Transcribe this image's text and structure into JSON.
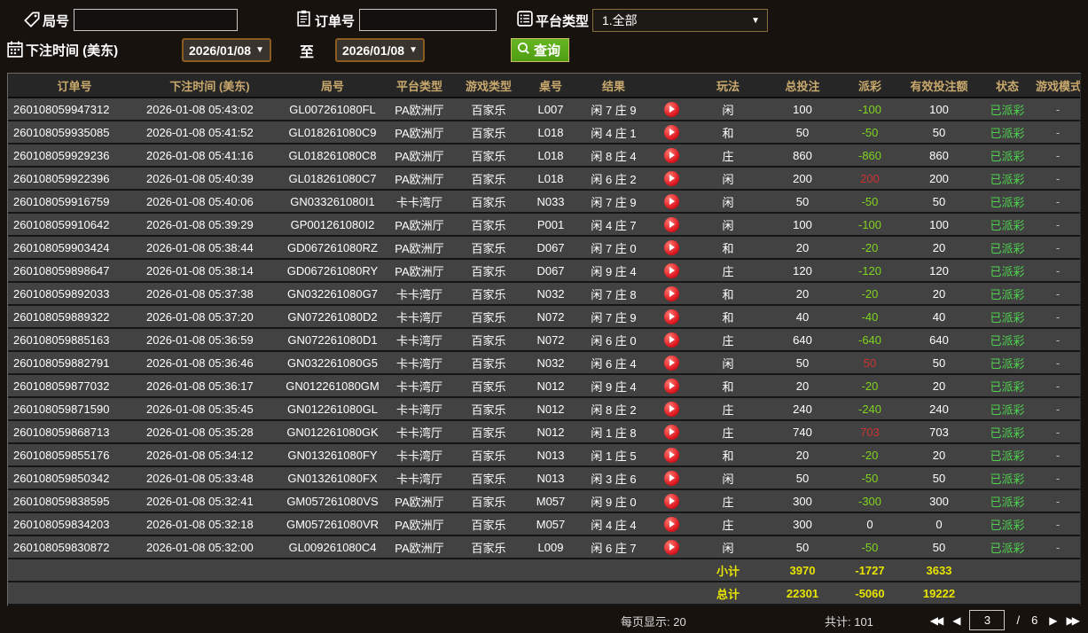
{
  "filters": {
    "round_label": "局号",
    "order_label": "订单号",
    "platform_label": "平台类型",
    "platform_value": "1.全部",
    "time_label": "下注时间 (美东)",
    "date_from": "2026/01/08",
    "to_label": "至",
    "date_to": "2026/01/08",
    "query_label": "查询"
  },
  "icons": {
    "dropdown_arrow": "▼",
    "pager_first": "◀◀",
    "pager_prev": "◀",
    "pager_next": "▶",
    "pager_last": "▶▶"
  },
  "colors": {
    "page_bg": "#17120e",
    "row_bg": "#424242",
    "header_text": "#c9a96d",
    "payout_negative": "#7fd41e",
    "payout_positive": "#cc3333",
    "status_green": "#4fd24f",
    "totals_yellow": "#e8e400",
    "query_button_green": "#55a318",
    "picker_border": "#8a5a1e",
    "play_button_red": "#e01b24"
  },
  "table": {
    "columns": [
      "订单号",
      "下注时间 (美东)",
      "局号",
      "平台类型",
      "游戏类型",
      "桌号",
      "结果",
      "",
      "玩法",
      "总投注",
      "派彩",
      "有效投注额",
      "状态",
      "游戏模式"
    ],
    "rows": [
      {
        "order": "260108059947312",
        "time": "2026-01-08 05:43:02",
        "round": "GL007261080FL",
        "platform": "PA欧洲厅",
        "game": "百家乐",
        "table_no": "L007",
        "result": "闲 7 庄 9",
        "bet": "闲",
        "total": "100",
        "payout": "-100",
        "valid": "100",
        "status": "已派彩",
        "mode": "-"
      },
      {
        "order": "260108059935085",
        "time": "2026-01-08 05:41:52",
        "round": "GL018261080C9",
        "platform": "PA欧洲厅",
        "game": "百家乐",
        "table_no": "L018",
        "result": "闲 4 庄 1",
        "bet": "和",
        "total": "50",
        "payout": "-50",
        "valid": "50",
        "status": "已派彩",
        "mode": "-"
      },
      {
        "order": "260108059929236",
        "time": "2026-01-08 05:41:16",
        "round": "GL018261080C8",
        "platform": "PA欧洲厅",
        "game": "百家乐",
        "table_no": "L018",
        "result": "闲 8 庄 4",
        "bet": "庄",
        "total": "860",
        "payout": "-860",
        "valid": "860",
        "status": "已派彩",
        "mode": "-"
      },
      {
        "order": "260108059922396",
        "time": "2026-01-08 05:40:39",
        "round": "GL018261080C7",
        "platform": "PA欧洲厅",
        "game": "百家乐",
        "table_no": "L018",
        "result": "闲 6 庄 2",
        "bet": "闲",
        "total": "200",
        "payout": "200",
        "valid": "200",
        "status": "已派彩",
        "mode": "-"
      },
      {
        "order": "260108059916759",
        "time": "2026-01-08 05:40:06",
        "round": "GN033261080I1",
        "platform": "卡卡湾厅",
        "game": "百家乐",
        "table_no": "N033",
        "result": "闲 7 庄 9",
        "bet": "闲",
        "total": "50",
        "payout": "-50",
        "valid": "50",
        "status": "已派彩",
        "mode": "-"
      },
      {
        "order": "260108059910642",
        "time": "2026-01-08 05:39:29",
        "round": "GP001261080I2",
        "platform": "PA欧洲厅",
        "game": "百家乐",
        "table_no": "P001",
        "result": "闲 4 庄 7",
        "bet": "闲",
        "total": "100",
        "payout": "-100",
        "valid": "100",
        "status": "已派彩",
        "mode": "-"
      },
      {
        "order": "260108059903424",
        "time": "2026-01-08 05:38:44",
        "round": "GD067261080RZ",
        "platform": "PA欧洲厅",
        "game": "百家乐",
        "table_no": "D067",
        "result": "闲 7 庄 0",
        "bet": "和",
        "total": "20",
        "payout": "-20",
        "valid": "20",
        "status": "已派彩",
        "mode": "-"
      },
      {
        "order": "260108059898647",
        "time": "2026-01-08 05:38:14",
        "round": "GD067261080RY",
        "platform": "PA欧洲厅",
        "game": "百家乐",
        "table_no": "D067",
        "result": "闲 9 庄 4",
        "bet": "庄",
        "total": "120",
        "payout": "-120",
        "valid": "120",
        "status": "已派彩",
        "mode": "-"
      },
      {
        "order": "260108059892033",
        "time": "2026-01-08 05:37:38",
        "round": "GN032261080G7",
        "platform": "卡卡湾厅",
        "game": "百家乐",
        "table_no": "N032",
        "result": "闲 7 庄 8",
        "bet": "和",
        "total": "20",
        "payout": "-20",
        "valid": "20",
        "status": "已派彩",
        "mode": "-"
      },
      {
        "order": "260108059889322",
        "time": "2026-01-08 05:37:20",
        "round": "GN072261080D2",
        "platform": "卡卡湾厅",
        "game": "百家乐",
        "table_no": "N072",
        "result": "闲 7 庄 9",
        "bet": "和",
        "total": "40",
        "payout": "-40",
        "valid": "40",
        "status": "已派彩",
        "mode": "-"
      },
      {
        "order": "260108059885163",
        "time": "2026-01-08 05:36:59",
        "round": "GN072261080D1",
        "platform": "卡卡湾厅",
        "game": "百家乐",
        "table_no": "N072",
        "result": "闲 6 庄 0",
        "bet": "庄",
        "total": "640",
        "payout": "-640",
        "valid": "640",
        "status": "已派彩",
        "mode": "-"
      },
      {
        "order": "260108059882791",
        "time": "2026-01-08 05:36:46",
        "round": "GN032261080G5",
        "platform": "卡卡湾厅",
        "game": "百家乐",
        "table_no": "N032",
        "result": "闲 6 庄 4",
        "bet": "闲",
        "total": "50",
        "payout": "50",
        "valid": "50",
        "status": "已派彩",
        "mode": "-"
      },
      {
        "order": "260108059877032",
        "time": "2026-01-08 05:36:17",
        "round": "GN012261080GM",
        "platform": "卡卡湾厅",
        "game": "百家乐",
        "table_no": "N012",
        "result": "闲 9 庄 4",
        "bet": "和",
        "total": "20",
        "payout": "-20",
        "valid": "20",
        "status": "已派彩",
        "mode": "-"
      },
      {
        "order": "260108059871590",
        "time": "2026-01-08 05:35:45",
        "round": "GN012261080GL",
        "platform": "卡卡湾厅",
        "game": "百家乐",
        "table_no": "N012",
        "result": "闲 8 庄 2",
        "bet": "庄",
        "total": "240",
        "payout": "-240",
        "valid": "240",
        "status": "已派彩",
        "mode": "-"
      },
      {
        "order": "260108059868713",
        "time": "2026-01-08 05:35:28",
        "round": "GN012261080GK",
        "platform": "卡卡湾厅",
        "game": "百家乐",
        "table_no": "N012",
        "result": "闲 1 庄 8",
        "bet": "庄",
        "total": "740",
        "payout": "703",
        "valid": "703",
        "status": "已派彩",
        "mode": "-"
      },
      {
        "order": "260108059855176",
        "time": "2026-01-08 05:34:12",
        "round": "GN013261080FY",
        "platform": "卡卡湾厅",
        "game": "百家乐",
        "table_no": "N013",
        "result": "闲 1 庄 5",
        "bet": "和",
        "total": "20",
        "payout": "-20",
        "valid": "20",
        "status": "已派彩",
        "mode": "-"
      },
      {
        "order": "260108059850342",
        "time": "2026-01-08 05:33:48",
        "round": "GN013261080FX",
        "platform": "卡卡湾厅",
        "game": "百家乐",
        "table_no": "N013",
        "result": "闲 3 庄 6",
        "bet": "闲",
        "total": "50",
        "payout": "-50",
        "valid": "50",
        "status": "已派彩",
        "mode": "-"
      },
      {
        "order": "260108059838595",
        "time": "2026-01-08 05:32:41",
        "round": "GM057261080VS",
        "platform": "PA欧洲厅",
        "game": "百家乐",
        "table_no": "M057",
        "result": "闲 9 庄 0",
        "bet": "庄",
        "total": "300",
        "payout": "-300",
        "valid": "300",
        "status": "已派彩",
        "mode": "-"
      },
      {
        "order": "260108059834203",
        "time": "2026-01-08 05:32:18",
        "round": "GM057261080VR",
        "platform": "PA欧洲厅",
        "game": "百家乐",
        "table_no": "M057",
        "result": "闲 4 庄 4",
        "bet": "庄",
        "total": "300",
        "payout": "0",
        "valid": "0",
        "status": "已派彩",
        "mode": "-"
      },
      {
        "order": "260108059830872",
        "time": "2026-01-08 05:32:00",
        "round": "GL009261080C4",
        "platform": "PA欧洲厅",
        "game": "百家乐",
        "table_no": "L009",
        "result": "闲 6 庄 7",
        "bet": "闲",
        "total": "50",
        "payout": "-50",
        "valid": "50",
        "status": "已派彩",
        "mode": "-"
      }
    ],
    "subtotal": {
      "label": "小计",
      "total": "3970",
      "payout": "-1727",
      "valid": "3633"
    },
    "grand_total": {
      "label": "总计",
      "total": "22301",
      "payout": "-5060",
      "valid": "19222"
    }
  },
  "footer": {
    "page_size_label": "每页显示: 20",
    "total_count_label": "共计: 101",
    "current_page": "3",
    "page_sep": "/",
    "total_pages": "6"
  }
}
